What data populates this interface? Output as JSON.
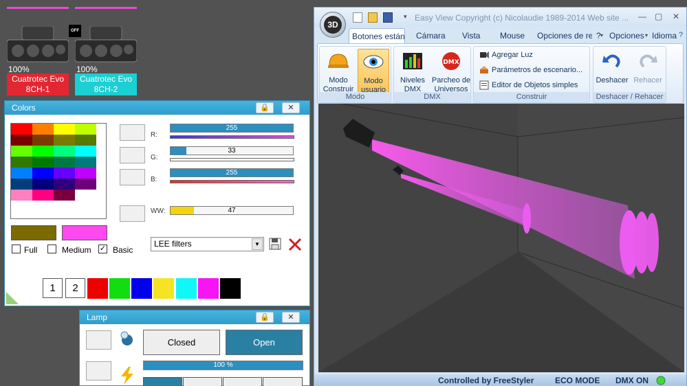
{
  "fixtures": [
    {
      "intensity": "100%",
      "name_line1": "Cuatrotec Evo",
      "name_line2": "8CH-1",
      "color": "#e32732"
    },
    {
      "intensity": "100%",
      "name_line1": "Cuatrotec Evo",
      "name_line2": "8CH-2",
      "color": "#1ccfd2"
    }
  ],
  "off_badge": "OFF",
  "colors_panel": {
    "title": "Colors",
    "channels": [
      {
        "label": "R:",
        "value": "255",
        "fraction": 1.0,
        "fill": "#2b8fbf",
        "under": "#e14be0"
      },
      {
        "label": "G:",
        "value": "33",
        "fraction": 0.13,
        "fill": "#2b8fbf",
        "under": "#e14be0"
      },
      {
        "label": "B:",
        "value": "255",
        "fraction": 1.0,
        "fill": "#2b8fbf",
        "under": "#ee2a2a"
      },
      {
        "label": "WW:",
        "value": "47",
        "fraction": 0.19,
        "fill": "#f5d30a",
        "under": ""
      }
    ],
    "preset_colors": [
      "#7a6a00",
      "#ff4af0"
    ],
    "checkboxes": [
      {
        "label": "Full",
        "checked": false
      },
      {
        "label": "Medium",
        "checked": false
      },
      {
        "label": "Basic",
        "checked": true
      }
    ],
    "filter_select": "LEE filters",
    "page_buttons": [
      "1",
      "2"
    ],
    "quick_colors": [
      "#ee0000",
      "#11dd11",
      "#0000ee",
      "#f6e323",
      "#11f7f7",
      "#f715f3",
      "#000000"
    ]
  },
  "lamp_panel": {
    "title": "Lamp",
    "closed_label": "Closed",
    "open_label": "Open",
    "intensity_value": "100 %",
    "intensity_fraction": 1.0
  },
  "window": {
    "title": "Easy View   Copyright (c) Nicolaudie 1989-2014   Web site ...",
    "orb_label": "3D",
    "tabs": [
      "Botones están",
      "Cámara",
      "Vista",
      "Mouse",
      "Opciones de re",
      "?",
      "Opciones",
      "Idioma"
    ],
    "groups": {
      "modo": {
        "label": "Modo",
        "buttons": [
          "Modo Construir",
          "Modo usuario"
        ]
      },
      "dmx": {
        "label": "DMX",
        "buttons": [
          "Niveles DMX",
          "Parcheo de Universos"
        ]
      },
      "construir": {
        "label": "Construir",
        "items": [
          "Agregar Luz",
          "Parámetros de escenario...",
          "Editor de Objetos simples"
        ]
      },
      "deshacer": {
        "label": "Deshacer / Rehacer",
        "buttons": [
          "Deshacer",
          "Rehacer"
        ]
      }
    },
    "status": [
      "Controlled by FreeStyler",
      "ECO MODE",
      "DMX ON"
    ]
  }
}
